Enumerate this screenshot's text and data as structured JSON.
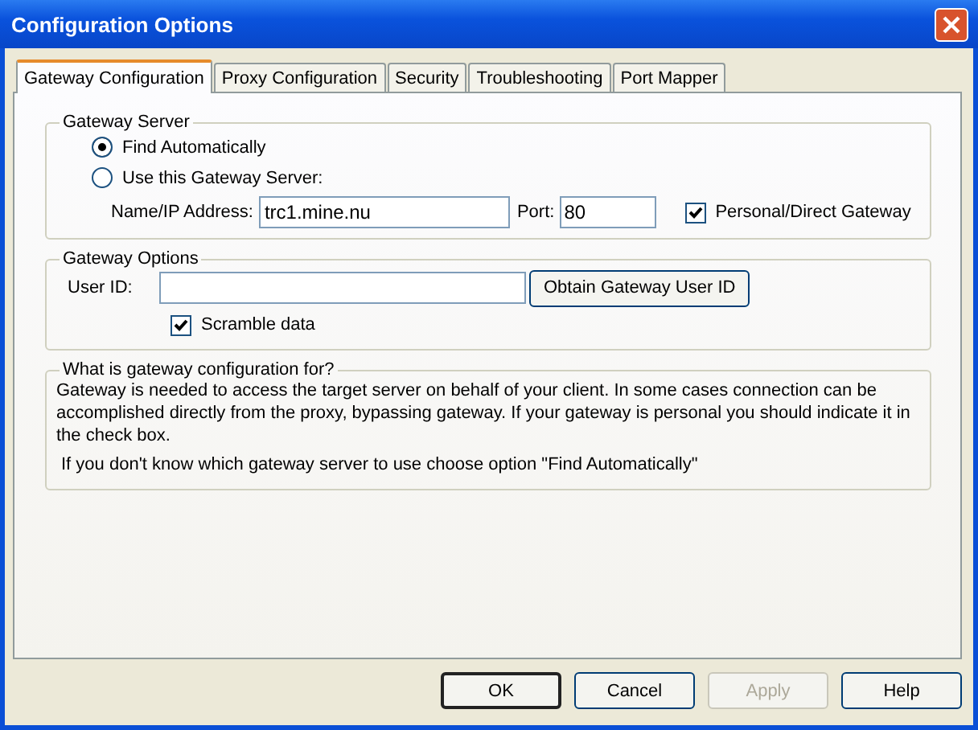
{
  "window": {
    "title": "Configuration Options"
  },
  "tabs": [
    {
      "label": "Gateway Configuration",
      "selected": true
    },
    {
      "label": "Proxy Configuration",
      "selected": false
    },
    {
      "label": "Security",
      "selected": false
    },
    {
      "label": "Troubleshooting",
      "selected": false
    },
    {
      "label": "Port Mapper",
      "selected": false
    }
  ],
  "gateway_server": {
    "title": "Gateway Server",
    "options": [
      {
        "label": "Find Automatically",
        "selected": true
      },
      {
        "label": "Use this Gateway Server:",
        "selected": false
      }
    ],
    "address_label": "Name/IP Address:",
    "address_value": "trc1.mine.nu",
    "port_label": "Port:",
    "port_value": "80",
    "personal": {
      "label": "Personal/Direct Gateway",
      "checked": true
    }
  },
  "gateway_options": {
    "title": "Gateway Options",
    "user_id_label": "User ID:",
    "obtain_button": "Obtain Gateway User ID",
    "scramble": {
      "label": "Scramble data",
      "checked": true
    }
  },
  "info": {
    "title": "What is gateway configuration for?",
    "paragraphs": [
      "Gateway is needed to access the target server on behalf of your client. In some cases connection can be accomplished directly from the proxy, bypassing gateway. If your gateway is personal you should indicate it in the check box.",
      "If you don't know which gateway server to use choose option \"Find Automatically\""
    ]
  },
  "buttons": [
    {
      "label": "OK",
      "disabled": false,
      "default": true
    },
    {
      "label": "Cancel",
      "disabled": false,
      "default": false
    },
    {
      "label": "Apply",
      "disabled": true,
      "default": false
    },
    {
      "label": "Help",
      "disabled": false,
      "default": false
    }
  ]
}
